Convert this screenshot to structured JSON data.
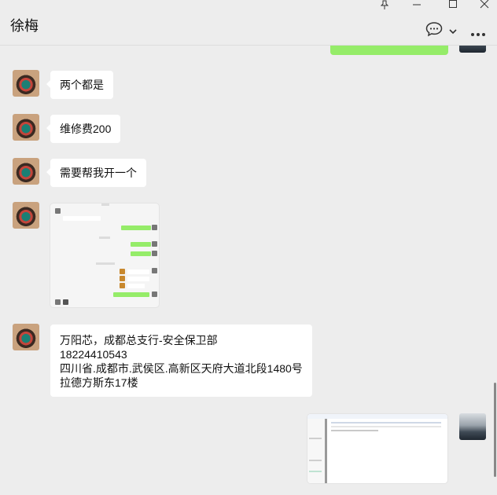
{
  "window": {
    "title": "徐梅",
    "controls": [
      "pin-icon",
      "maximize-icon",
      "close-icon"
    ],
    "header_icons": [
      "chat-bubble-icon",
      "chevron-down-icon",
      "more-icon"
    ]
  },
  "messages": {
    "m1": "两个都是",
    "m2": "维修费200",
    "m3": "需要帮我开一个",
    "card": {
      "line1": "万阳芯，成都总支行-安全保卫部",
      "line2": "18224410543",
      "line3": "四川省.成都市.武侯区.高新区天府大道北段1480号",
      "line4": "拉德方斯东17楼"
    }
  },
  "colors": {
    "background": "#ededed",
    "bubble_incoming": "#ffffff",
    "bubble_outgoing": "#95ec69"
  }
}
